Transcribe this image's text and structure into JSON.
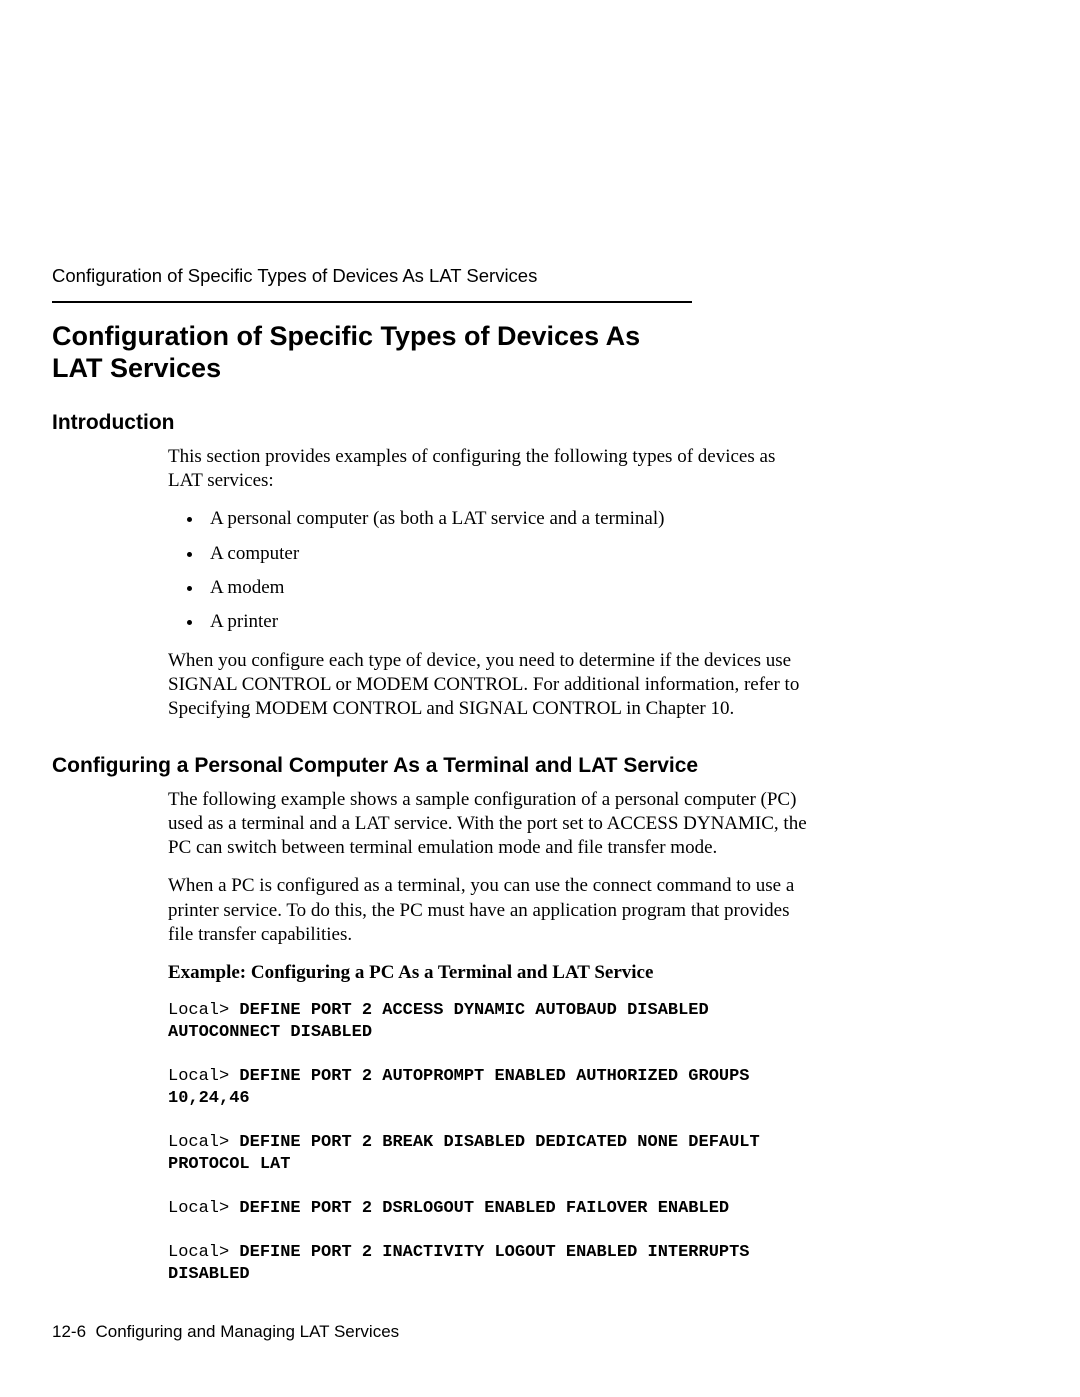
{
  "running_head": "Configuration of Specific Types of Devices As LAT Services",
  "h1": "Configuration of Specific Types of Devices As LAT Services",
  "intro": {
    "heading": "Introduction",
    "p1": "This section provides examples of configuring the following types of devices as LAT services:",
    "bullets": [
      "A personal computer (as both a LAT service and a terminal)",
      "A computer",
      "A modem",
      "A printer"
    ],
    "p2": "When you configure each type of device, you need to determine if the devices use SIGNAL CONTROL or MODEM CONTROL. For additional information, refer to Specifying MODEM CONTROL and SIGNAL CONTROL in Chapter 10."
  },
  "configpc": {
    "heading": "Configuring a Personal Computer As a Terminal and LAT Service",
    "p1": "The following example shows a sample configuration of a personal computer (PC) used as a terminal and a LAT service. With the port set to ACCESS DYNAMIC, the PC can switch between terminal emulation mode and file transfer mode.",
    "p2": "When a PC is configured as a terminal, you can use the connect command to use a printer service. To do this, the PC must have an application program that provides file transfer capabilities.",
    "example_title": "Example: Configuring a PC As a Terminal and LAT Service",
    "commands": [
      {
        "prompt": "Local> ",
        "cmd": "DEFINE PORT 2 ACCESS DYNAMIC AUTOBAUD DISABLED AUTOCONNECT DISABLED"
      },
      {
        "prompt": "Local> ",
        "cmd": "DEFINE PORT 2 AUTOPROMPT ENABLED AUTHORIZED GROUPS 10,24,46"
      },
      {
        "prompt": "Local> ",
        "cmd": "DEFINE PORT 2 BREAK DISABLED DEDICATED NONE DEFAULT PROTOCOL LAT"
      },
      {
        "prompt": "Local> ",
        "cmd": "DEFINE PORT 2 DSRLOGOUT ENABLED FAILOVER ENABLED"
      },
      {
        "prompt": "Local> ",
        "cmd": "DEFINE PORT 2 INACTIVITY LOGOUT ENABLED INTERRUPTS DISABLED"
      }
    ]
  },
  "footer": {
    "page": "12-6",
    "title": "Configuring and Managing LAT Services"
  }
}
